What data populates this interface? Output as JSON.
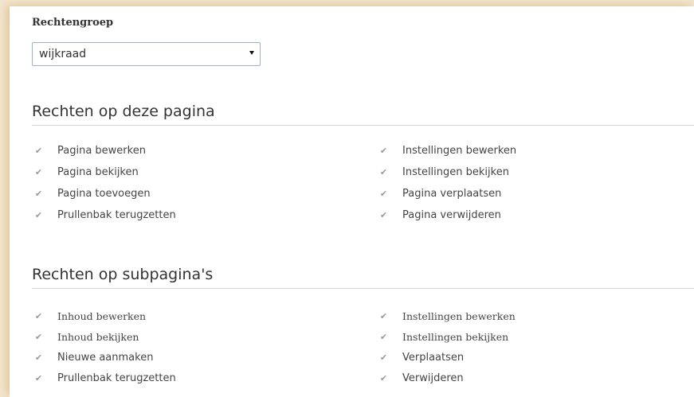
{
  "rights_group": {
    "label": "Rechtengroep",
    "selected": "wijkraad"
  },
  "sections": [
    {
      "title": "Rechten op deze pagina",
      "left": [
        {
          "label": "Pagina bewerken",
          "checked": true
        },
        {
          "label": "Pagina bekijken",
          "checked": true
        },
        {
          "label": "Pagina toevoegen",
          "checked": true
        },
        {
          "label": "Prullenbak terugzetten",
          "checked": true
        }
      ],
      "right": [
        {
          "label": "Instellingen bewerken",
          "checked": true
        },
        {
          "label": "Instellingen bekijken",
          "checked": true
        },
        {
          "label": "Pagina verplaatsen",
          "checked": true
        },
        {
          "label": "Pagina verwijderen",
          "checked": true
        }
      ]
    },
    {
      "title": "Rechten op subpagina's",
      "left": [
        {
          "label": "Inhoud bewerken",
          "checked": true
        },
        {
          "label": "Inhoud bekijken",
          "checked": true
        },
        {
          "label": "Nieuwe aanmaken",
          "checked": true
        },
        {
          "label": "Prullenbak terugzetten",
          "checked": true
        }
      ],
      "right": [
        {
          "label": "Instellingen bewerken",
          "checked": true
        },
        {
          "label": "Instellingen bekijken",
          "checked": true
        },
        {
          "label": "Verplaatsen",
          "checked": true
        },
        {
          "label": "Verwijderen",
          "checked": true
        }
      ]
    }
  ]
}
